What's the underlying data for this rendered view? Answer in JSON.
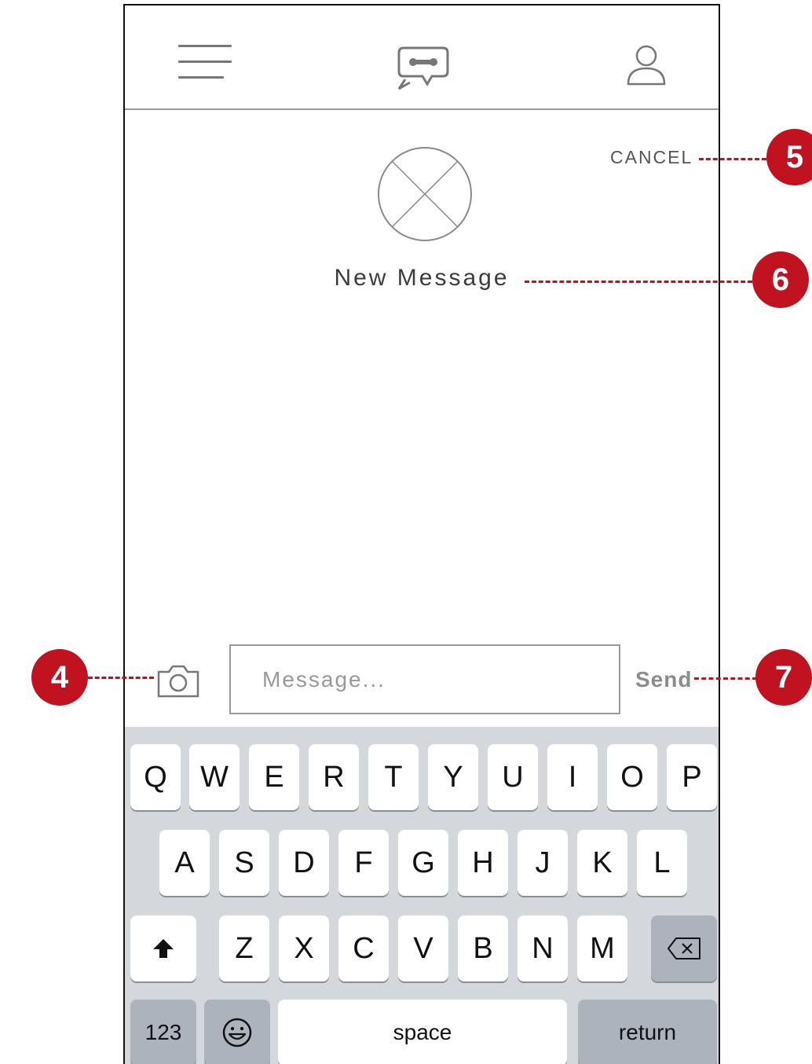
{
  "header": {
    "menu_icon": "hamburger-menu-icon",
    "logo_icon": "chat-wrench-logo-icon",
    "profile_icon": "user-profile-icon"
  },
  "compose": {
    "cancel_label": "CANCEL",
    "avatar_icon": "image-placeholder-icon",
    "title": "New Message"
  },
  "input_bar": {
    "camera_icon": "camera-icon",
    "placeholder": "Message...",
    "value": "",
    "send_label": "Send"
  },
  "keyboard": {
    "row1": [
      "Q",
      "W",
      "E",
      "R",
      "T",
      "Y",
      "U",
      "I",
      "O",
      "P"
    ],
    "row2": [
      "A",
      "S",
      "D",
      "F",
      "G",
      "H",
      "J",
      "K",
      "L"
    ],
    "row3": [
      "Z",
      "X",
      "C",
      "V",
      "B",
      "N",
      "M"
    ],
    "shift_icon": "shift-arrow-icon",
    "delete_icon": "backspace-icon",
    "numbers_label": "123",
    "emoji_icon": "emoji-icon",
    "space_label": "space",
    "return_label": "return"
  },
  "callouts": {
    "c4": "4",
    "c5": "5",
    "c6": "6",
    "c7": "7"
  },
  "colors": {
    "accent": "#c1121f",
    "keyboard_bg": "#d4d7dc",
    "text_gray": "#8c8c8c"
  }
}
